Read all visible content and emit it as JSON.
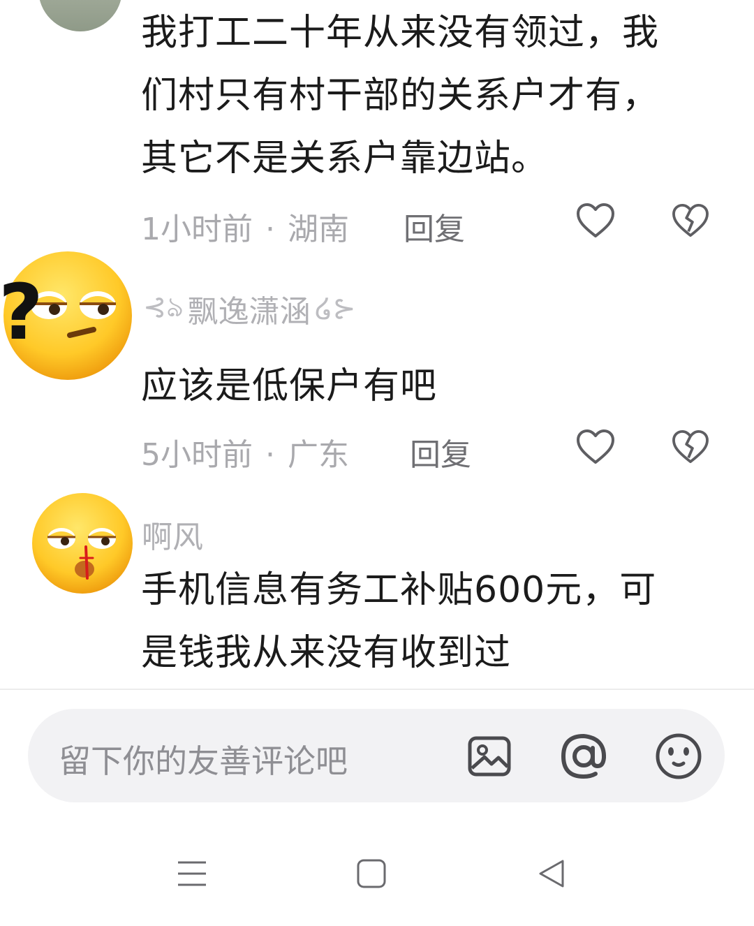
{
  "comments": [
    {
      "username": "",
      "text_lines": [
        "我打工二十年从来没有领过，我",
        "们村只有村干部的关系户才有，",
        "其它不是关系户靠边站。"
      ],
      "time": "1小时前",
      "location": "湖南",
      "reply_label": "回复"
    },
    {
      "username": "飘逸潇涵",
      "text_lines": [
        "应该是低保户有吧"
      ],
      "time": "5小时前",
      "location": "广东",
      "reply_label": "回复"
    },
    {
      "username": "啊风",
      "text_lines": [
        "手机信息有务工补贴600元，可",
        "是钱我从来没有收到过"
      ]
    }
  ],
  "input": {
    "placeholder": "留下你的友善评论吧"
  },
  "icons": {
    "like": "heart-outline-icon",
    "dislike": "broken-heart-icon",
    "image": "image-icon",
    "mention": "at-icon",
    "emoji": "emoji-icon"
  },
  "nav": [
    "menu-icon",
    "home-icon",
    "back-icon"
  ],
  "colors": {
    "text": "#1b1b1b",
    "meta": "#a9a9ad",
    "input_bg": "#f2f2f4"
  }
}
